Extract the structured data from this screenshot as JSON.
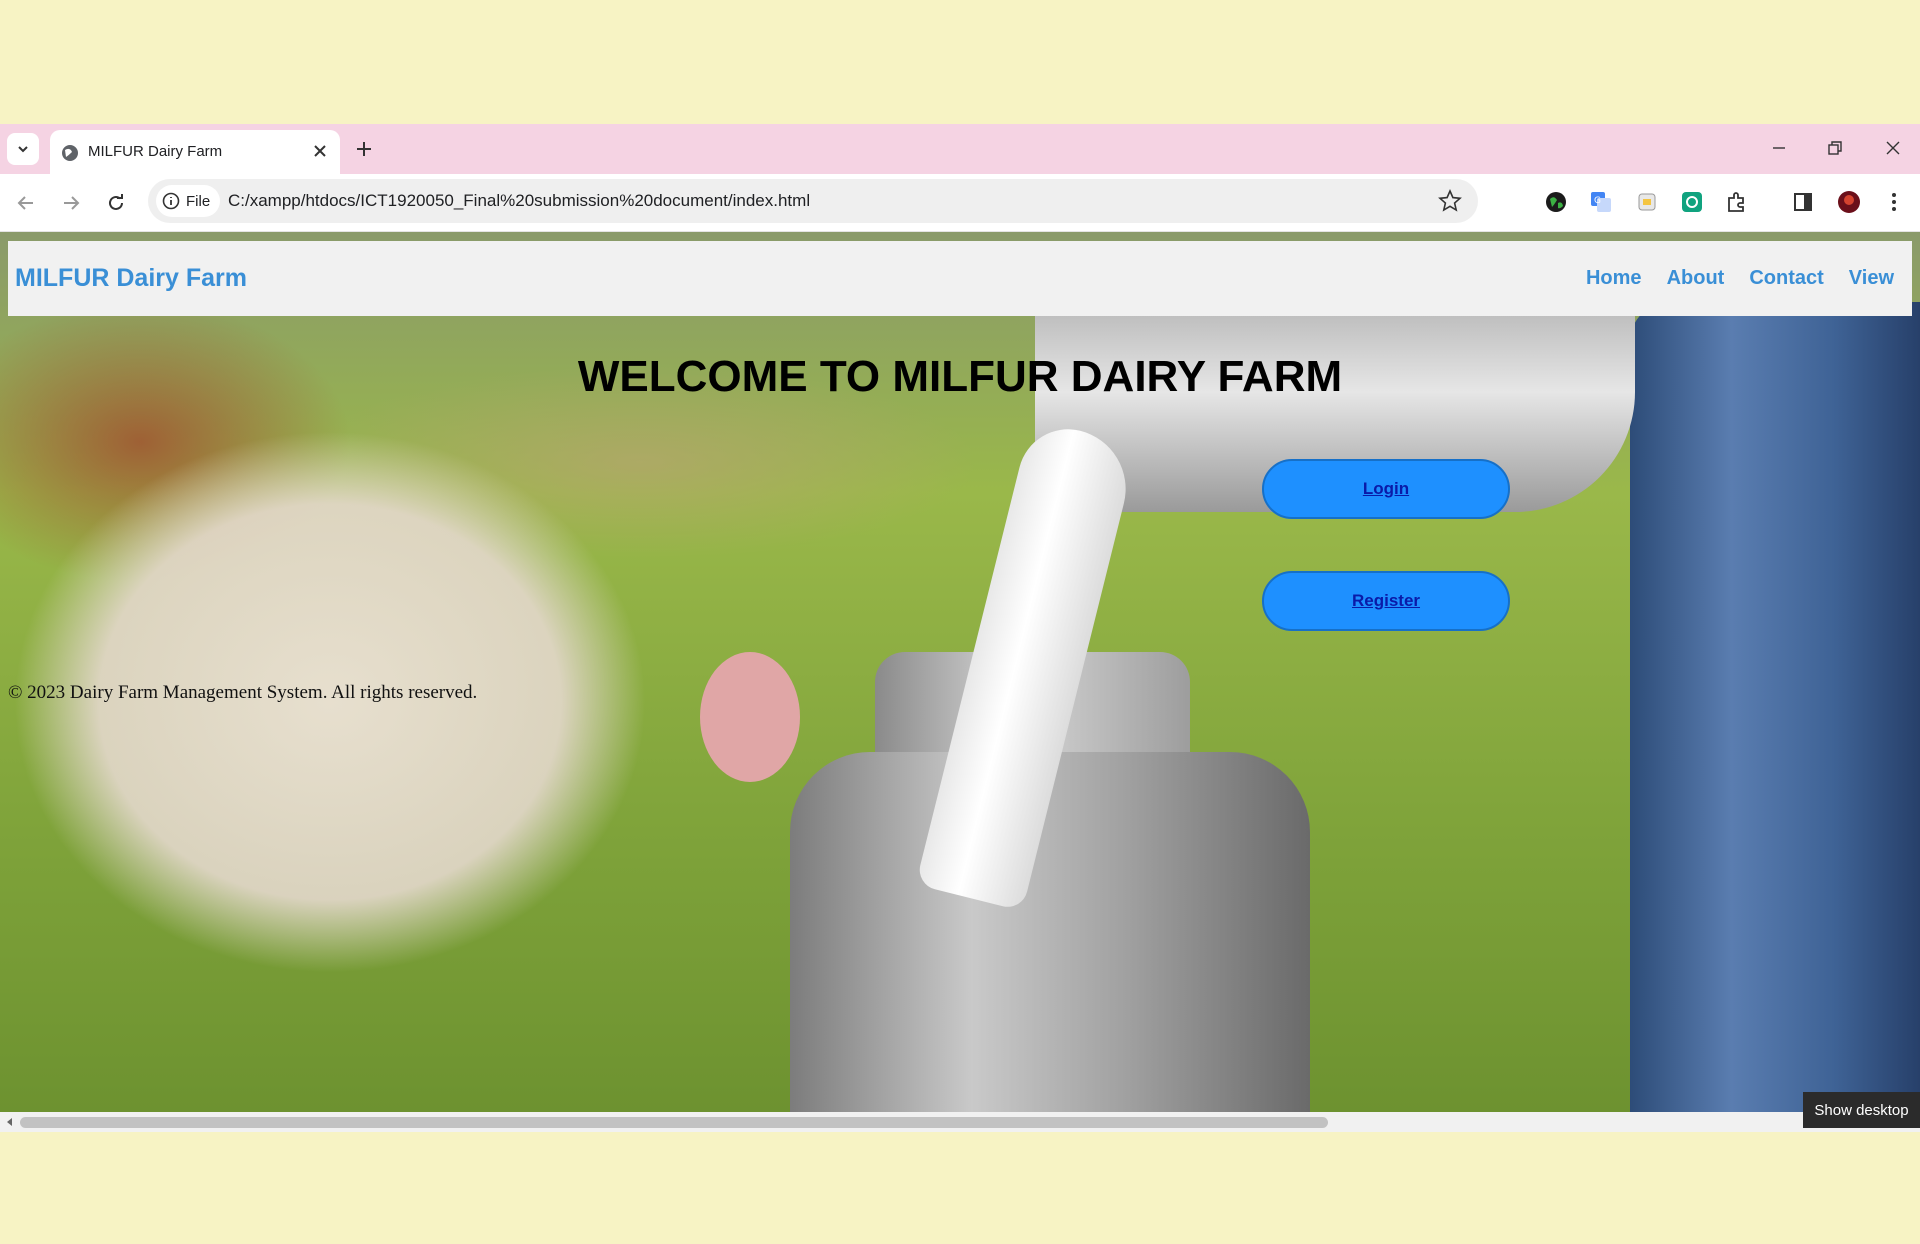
{
  "browser": {
    "tab_title": "MILFUR Dairy Farm",
    "security_chip": "File",
    "url": "C:/xampp/htdocs/ICT1920050_Final%20submission%20document/index.html"
  },
  "site": {
    "brand": "MILFUR Dairy Farm",
    "nav": [
      "Home",
      "About",
      "Contact",
      "View"
    ],
    "hero_title": "WELCOME TO MILFUR DAIRY FARM",
    "login_label": "Login",
    "register_label": "Register",
    "footer": "© 2023 Dairy Farm Management System. All rights reserved."
  },
  "os": {
    "tooltip": "Show desktop"
  },
  "icons": [
    "tab-search-icon",
    "globe-icon",
    "close-icon",
    "plus-icon",
    "minimize-icon",
    "restore-icon",
    "back-icon",
    "forward-icon",
    "reload-icon",
    "info-icon",
    "star-icon",
    "extension-icon",
    "puzzle-icon",
    "side-panel-icon",
    "profile-avatar-icon",
    "kebab-menu-icon"
  ],
  "colors": {
    "tabstrip": "#f5d3e3",
    "desktop": "#f7f3c4",
    "brand_blue": "#3a8fd6",
    "button_blue": "#1e90ff"
  }
}
